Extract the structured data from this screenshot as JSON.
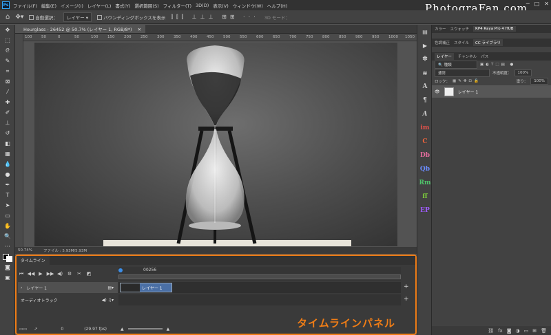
{
  "menu": [
    "ファイル(F)",
    "編集(E)",
    "イメージ(I)",
    "レイヤー(L)",
    "書式(Y)",
    "選択範囲(S)",
    "フィルター(T)",
    "3D(D)",
    "表示(V)",
    "ウィンドウ(W)",
    "ヘルプ(H)"
  ],
  "watermark": "PhotograFan.com",
  "options": {
    "auto_select": "自動選択：",
    "auto_select_value": "レイヤー",
    "transform": "バウンディングボックスを表示",
    "mode3d": "3D モード："
  },
  "document": {
    "tab": "Hourglass - 26452 @ 50.7% (レイヤー 1, RGB/8*)",
    "zoom": "50.74%",
    "file_info": "ファイル : 5.93M/5.93M"
  },
  "ruler_ticks": [
    "100",
    "50",
    "0",
    "50",
    "100",
    "150",
    "200",
    "250",
    "300",
    "350",
    "400",
    "450",
    "500",
    "550",
    "600",
    "650",
    "700",
    "750",
    "800",
    "850",
    "900",
    "950",
    "1000",
    "1050"
  ],
  "timeline": {
    "tab": "タイムライン",
    "timecode": "00256",
    "track_name": "レイヤー 1",
    "clip_label": "レイヤー 1",
    "audio_track": "オーディオトラック",
    "frame": "0",
    "fps": "(29.97 fps)"
  },
  "annotation": "タイムラインパネル",
  "right_icons": [
    "A",
    "¶",
    "A",
    "im",
    "C",
    "Db",
    "Qb",
    "Rm",
    "ff",
    "EP"
  ],
  "right_icon_colors": [
    "#cccccc",
    "#cccccc",
    "#cccccc",
    "#e8524a",
    "#f0643c",
    "#e36c9c",
    "#6b8cff",
    "#4fc36a",
    "#7fd13b",
    "#a05cff"
  ],
  "panel": {
    "tabs_top": [
      "カラー",
      "スウォッチ",
      "RP4 Raya Pro 4 HUB"
    ],
    "tabs_mid": [
      "色調補正",
      "スタイル",
      "CC ライブラリ"
    ],
    "tabs_layer": [
      "レイヤー",
      "チャンネル",
      "パス"
    ],
    "kind": "種類",
    "blend": "通常",
    "opacity_label": "不透明度：",
    "opacity": "100%",
    "lock": "ロック：",
    "fill_label": "塗り：",
    "fill": "100%",
    "layer_name": "レイヤー 1"
  }
}
